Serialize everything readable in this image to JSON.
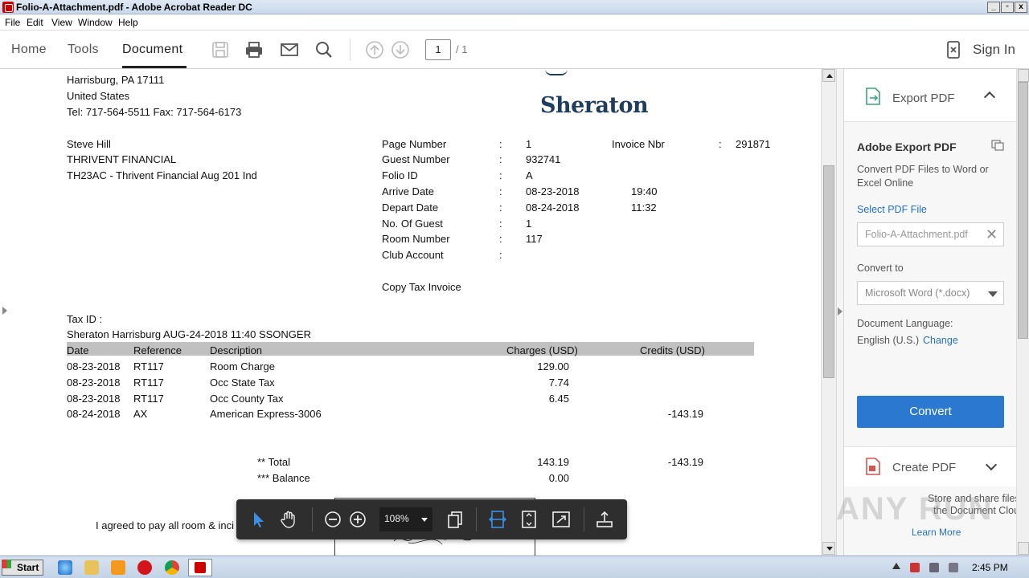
{
  "window": {
    "title": "Folio-A-Attachment.pdf - Adobe Acrobat Reader DC",
    "minimize": "_",
    "maximize": "▫",
    "close": "x"
  },
  "menubar": [
    "File",
    "Edit",
    "View",
    "Window",
    "Help"
  ],
  "toolbar": {
    "tabs": [
      "Home",
      "Tools",
      "Document"
    ],
    "active_tab": "Document",
    "page_current": "1",
    "page_total": "/ 1",
    "sign_in": "Sign In"
  },
  "document": {
    "address_line1": "Harrisburg, PA  17111",
    "address_line2": "United States",
    "phone": "Tel: 717-564-5511 Fax: 717-564-6173",
    "logo": "Sheraton",
    "guest_name": "Steve Hill",
    "company": "THRIVENT FINANCIAL",
    "group": "TH23AC - Thrivent Financial Aug 201 Ind",
    "fields": [
      {
        "label": "Page Number",
        "sep": ":",
        "value": "1",
        "extra": ""
      },
      {
        "label": "Guest Number",
        "sep": ":",
        "value": "932741",
        "extra": ""
      },
      {
        "label": "Folio ID",
        "sep": ":",
        "value": "A",
        "extra": ""
      },
      {
        "label": "Arrive Date",
        "sep": ":",
        "value": "08-23-2018",
        "extra": "19:40"
      },
      {
        "label": "Depart Date",
        "sep": ":",
        "value": "08-24-2018",
        "extra": "11:32"
      },
      {
        "label": "No. Of Guest",
        "sep": ":",
        "value": "1",
        "extra": ""
      },
      {
        "label": "Room Number",
        "sep": ":",
        "value": "117",
        "extra": ""
      },
      {
        "label": "Club Account",
        "sep": ":",
        "value": "",
        "extra": ""
      }
    ],
    "invoice_label": "Invoice Nbr",
    "invoice_sep": ":",
    "invoice_value": "291871",
    "copy_label": "Copy Tax Invoice",
    "tax_id": "Tax ID :",
    "hotel_line": "Sheraton Harrisburg  AUG-24-2018  11:40  SSONGER",
    "table_headers": {
      "date": "Date",
      "reference": "Reference",
      "description": "Description",
      "charges": "Charges (USD)",
      "credits": "Credits (USD)"
    },
    "rows": [
      {
        "date": "08-23-2018",
        "reference": "RT117",
        "description": "Room Charge",
        "charges": "129.00",
        "credits": ""
      },
      {
        "date": "08-23-2018",
        "reference": "RT117",
        "description": "Occ State Tax",
        "charges": "7.74",
        "credits": ""
      },
      {
        "date": "08-23-2018",
        "reference": "RT117",
        "description": "Occ County Tax",
        "charges": "6.45",
        "credits": ""
      },
      {
        "date": "08-24-2018",
        "reference": "AX",
        "description": "American Express-3006",
        "charges": "",
        "credits": "-143.19"
      }
    ],
    "total_label": "** Total",
    "total_charges": "143.19",
    "total_credits": "-143.19",
    "balance_label": "*** Balance",
    "balance_value": "0.00",
    "agreement_text": "I agreed to pay all room & inci"
  },
  "floating_toolbar": {
    "zoom": "108%"
  },
  "right_panel": {
    "export_title": "Export PDF",
    "aep_title": "Adobe Export PDF",
    "aep_desc": "Convert PDF Files to Word or Excel Online",
    "select_file": "Select PDF File",
    "file_name": "Folio-A-Attachment.pdf",
    "convert_to": "Convert to",
    "format": "Microsoft Word (*.docx)",
    "doc_lang_label": "Document Language:",
    "doc_lang_value": "English (U.S.)",
    "doc_lang_change": "Change",
    "convert_button": "Convert",
    "create_title": "Create PDF",
    "cloud_text": "Store and share files in the Document Cloud",
    "learn_more": "Learn More"
  },
  "watermark": "ANY RUN",
  "taskbar": {
    "start": "Start",
    "clock": "2:45 PM"
  },
  "colors": {
    "accent_blue": "#2b78d0",
    "link_blue": "#2473c4",
    "acrobat_red": "#cc0000",
    "logo_navy": "#1f3d5c"
  }
}
